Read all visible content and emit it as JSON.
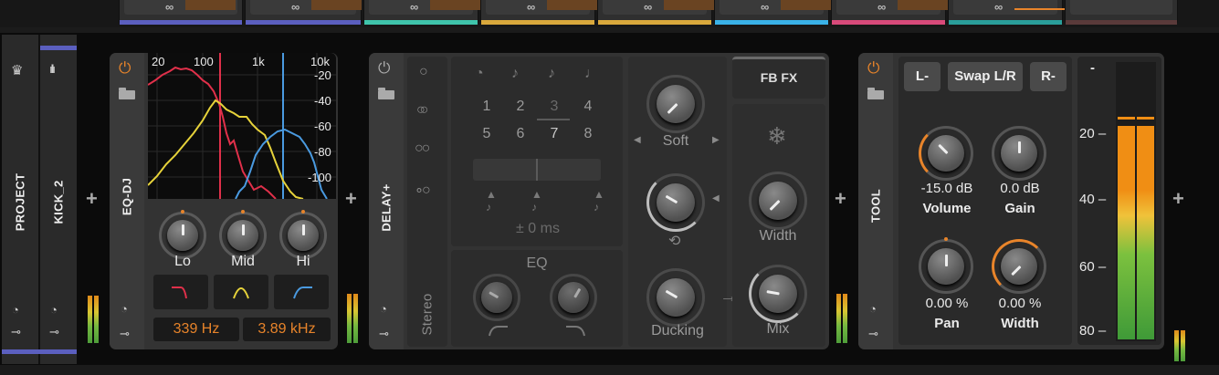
{
  "top_clips": {
    "symbol": "∞",
    "colors": [
      "#5b5fbf",
      "#5b5fbf",
      "#3fc4ab",
      "#d9a83c",
      "#d9a83c",
      "#3ab2e8",
      "#d84a7a",
      "#2a9e9a",
      "#5a3a3a"
    ]
  },
  "tracks": {
    "project": {
      "label": "PROJECT",
      "stripe_color": "#2a2a2a"
    },
    "kick": {
      "label": "KICK_2",
      "stripe_color": "#5b5fbf"
    }
  },
  "eq_dj": {
    "name": "EQ-DJ",
    "freq_labels": [
      "20",
      "100",
      "1k",
      "10k"
    ],
    "db_labels": [
      "-20",
      "-40",
      "-60",
      "-80",
      "-100"
    ],
    "knobs": [
      {
        "label": "Lo"
      },
      {
        "label": "Mid"
      },
      {
        "label": "Hi"
      }
    ],
    "low_freq": "339 Hz",
    "high_freq": "3.89 kHz"
  },
  "delay": {
    "name": "DELAY+",
    "mode_label": "Stereo",
    "numbers": [
      "1",
      "2",
      "3",
      "4",
      "5",
      "6",
      "7",
      "8"
    ],
    "offset": "± 0 ms",
    "eq_label": "EQ",
    "soft_label": "Soft",
    "fb_fx_label": "FB FX",
    "width_label": "Width",
    "ducking_label": "Ducking",
    "mix_label": "Mix",
    "arrow": "→"
  },
  "tool": {
    "name": "TOOL",
    "left_btn": "L-",
    "swap_btn": "Swap L/R",
    "right_btn": "R-",
    "volume_value": "-15.0 dB",
    "volume_label": "Volume",
    "gain_value": "0.0 dB",
    "gain_label": "Gain",
    "pan_value": "0.00 %",
    "pan_label": "Pan",
    "width_value": "0.00 %",
    "width_label": "Width",
    "scale": [
      "-",
      "20 –",
      "40 –",
      "60 –",
      "80 –"
    ]
  },
  "add_symbol": "+",
  "colors": {
    "accent": "#e8842a",
    "red": "#e0304a",
    "yellow": "#e6d23a",
    "blue": "#4a9ae0"
  }
}
